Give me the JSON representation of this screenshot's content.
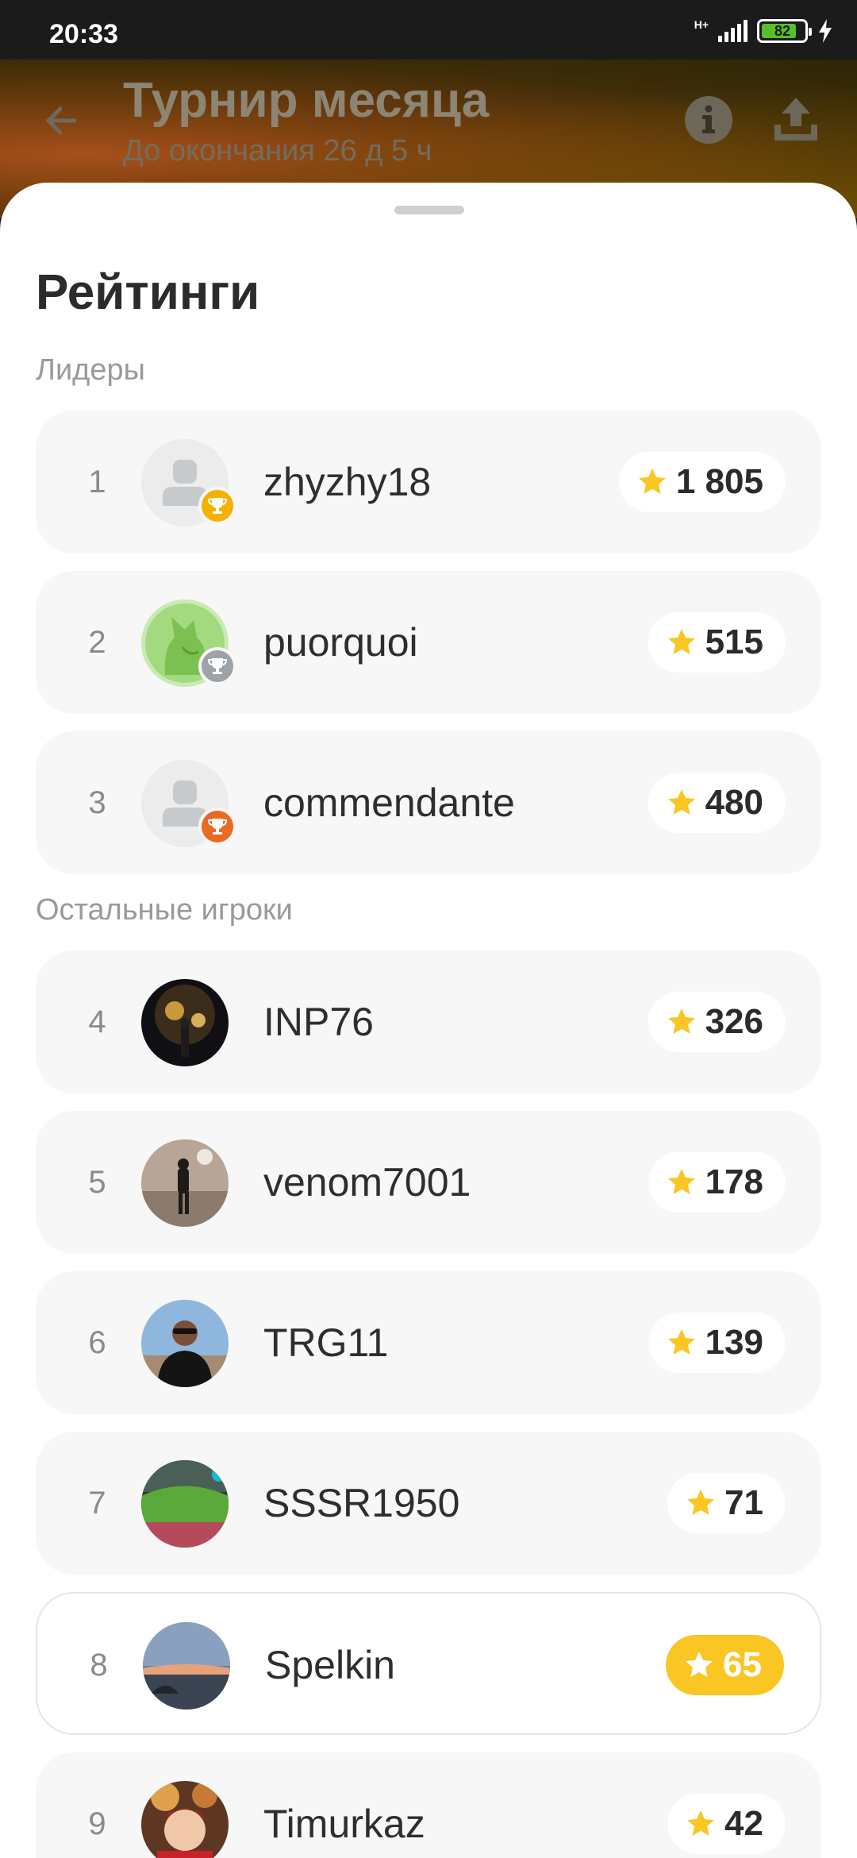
{
  "status_bar": {
    "time": "20:33",
    "network": "H+",
    "battery": "82",
    "battery_level": 0.82
  },
  "header": {
    "title": "Турнир месяца",
    "subtitle": "До окончания 26 д 5 ч"
  },
  "sheet": {
    "title": "Рейтинги",
    "leaders_label": "Лидеры",
    "others_label": "Остальные игроки"
  },
  "colors": {
    "accent": "#f9c623",
    "gold": "#f5b100",
    "silver": "#9ea3a8",
    "bronze": "#ea6a24"
  },
  "leaders": [
    {
      "rank": "1",
      "name": "zhyzhy18",
      "score": "1 805",
      "avatar": "default-avatar-icon",
      "trophy": "gold"
    },
    {
      "rank": "2",
      "name": "puorquoi",
      "score": "515",
      "avatar": "cat-avatar",
      "trophy": "silver"
    },
    {
      "rank": "3",
      "name": "commendante",
      "score": "480",
      "avatar": "default-avatar-icon",
      "trophy": "bronze"
    }
  ],
  "others": [
    {
      "rank": "4",
      "name": "INP76",
      "score": "326"
    },
    {
      "rank": "5",
      "name": "venom7001",
      "score": "178"
    },
    {
      "rank": "6",
      "name": "TRG11",
      "score": "139"
    },
    {
      "rank": "7",
      "name": "SSSR1950",
      "score": "71"
    },
    {
      "rank": "8",
      "name": "Spelkin",
      "score": "65",
      "current_user": true
    },
    {
      "rank": "9",
      "name": "Timurkaz",
      "score": "42"
    }
  ]
}
